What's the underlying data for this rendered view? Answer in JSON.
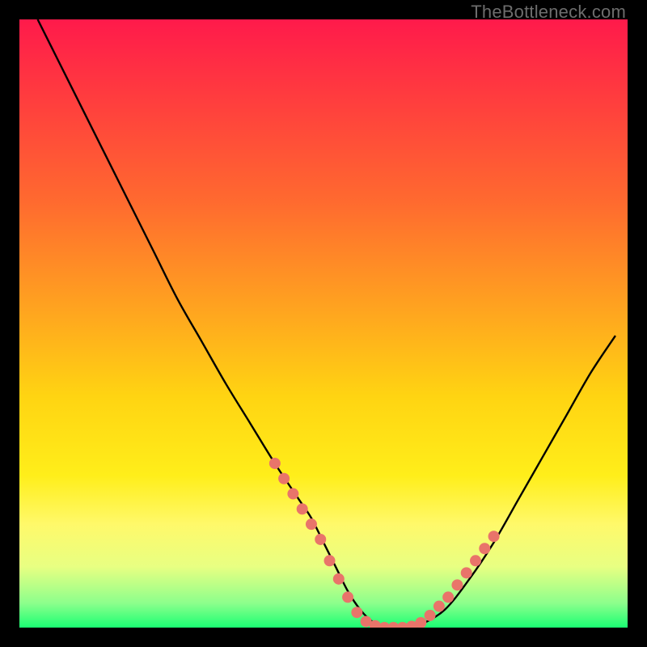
{
  "watermark": "TheBottleneck.com",
  "chart_data": {
    "type": "line",
    "title": "",
    "xlabel": "",
    "ylabel": "",
    "xlim": [
      0,
      100
    ],
    "ylim": [
      0,
      100
    ],
    "background_gradient": {
      "stops": [
        {
          "offset": 0.0,
          "color": "#ff1a4b"
        },
        {
          "offset": 0.12,
          "color": "#ff3a3f"
        },
        {
          "offset": 0.3,
          "color": "#ff6a2f"
        },
        {
          "offset": 0.48,
          "color": "#ffa51f"
        },
        {
          "offset": 0.62,
          "color": "#ffd412"
        },
        {
          "offset": 0.75,
          "color": "#ffee1a"
        },
        {
          "offset": 0.83,
          "color": "#fff96a"
        },
        {
          "offset": 0.9,
          "color": "#e8ff82"
        },
        {
          "offset": 0.96,
          "color": "#8cff8c"
        },
        {
          "offset": 1.0,
          "color": "#1aff73"
        }
      ]
    },
    "series": [
      {
        "name": "bottleneck-curve",
        "color": "#000000",
        "x": [
          3,
          6,
          10,
          14,
          18,
          22,
          26,
          30,
          34,
          38,
          42,
          46,
          48,
          50,
          52,
          54,
          56,
          58,
          60,
          62,
          64,
          66,
          70,
          74,
          78,
          82,
          86,
          90,
          94,
          98
        ],
        "y": [
          100,
          94,
          86,
          78,
          70,
          62,
          54,
          47,
          40,
          33.5,
          27,
          21,
          18,
          14,
          10,
          6,
          3,
          1,
          0,
          0,
          0,
          0.5,
          3,
          8,
          14,
          21,
          28,
          35,
          42,
          48
        ]
      }
    ],
    "markers": {
      "name": "highlight-dots",
      "color": "#e9746a",
      "radius": 7,
      "points": [
        {
          "x": 42,
          "y": 27
        },
        {
          "x": 43.5,
          "y": 24.5
        },
        {
          "x": 45,
          "y": 22
        },
        {
          "x": 46.5,
          "y": 19.5
        },
        {
          "x": 48,
          "y": 17
        },
        {
          "x": 49.5,
          "y": 14.5
        },
        {
          "x": 51,
          "y": 11
        },
        {
          "x": 52.5,
          "y": 8
        },
        {
          "x": 54,
          "y": 5
        },
        {
          "x": 55.5,
          "y": 2.5
        },
        {
          "x": 57,
          "y": 1
        },
        {
          "x": 58.5,
          "y": 0.3
        },
        {
          "x": 60,
          "y": 0
        },
        {
          "x": 61.5,
          "y": 0
        },
        {
          "x": 63,
          "y": 0
        },
        {
          "x": 64.5,
          "y": 0.2
        },
        {
          "x": 66,
          "y": 0.8
        },
        {
          "x": 67.5,
          "y": 2
        },
        {
          "x": 69,
          "y": 3.5
        },
        {
          "x": 70.5,
          "y": 5
        },
        {
          "x": 72,
          "y": 7
        },
        {
          "x": 73.5,
          "y": 9
        },
        {
          "x": 75,
          "y": 11
        },
        {
          "x": 76.5,
          "y": 13
        },
        {
          "x": 78,
          "y": 15
        }
      ]
    }
  }
}
